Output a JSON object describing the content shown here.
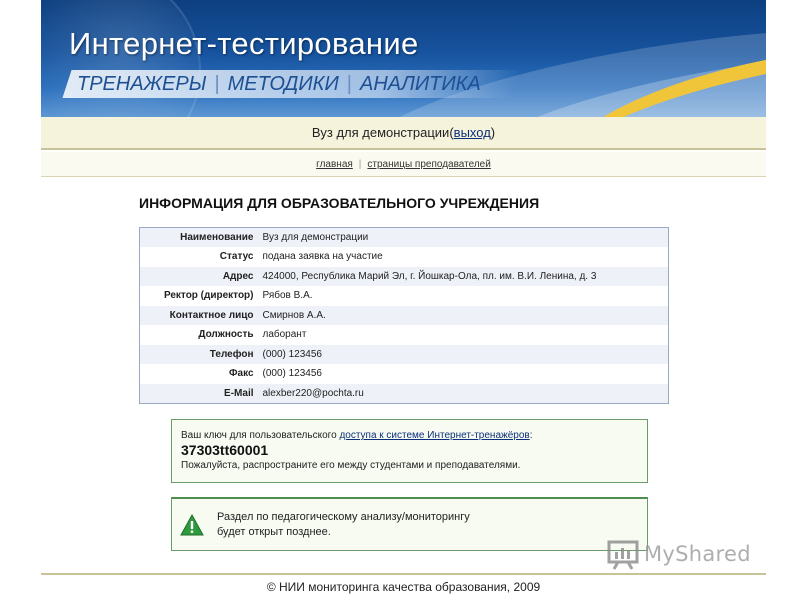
{
  "header": {
    "title": "Интернет-тестирование",
    "nav": [
      {
        "label": "ТРЕНАЖЕРЫ"
      },
      {
        "label": "МЕТОДИКИ"
      },
      {
        "label": "АНАЛИТИКА"
      }
    ],
    "nav_separator": "|"
  },
  "orgbar": {
    "org_name": "Вуз для демонстрации",
    "open_paren": " (",
    "logout_label": "выход",
    "close_paren": ")"
  },
  "subnav": {
    "home_label": "главная",
    "divider": "|",
    "teachers_label": "страницы преподавателей"
  },
  "section_title": "ИНФОРМАЦИЯ ДЛЯ ОБРАЗОВАТЕЛЬНОГО УЧРЕЖДЕНИЯ",
  "info_rows": [
    {
      "label": "Наименование",
      "value": "Вуз для демонстрации"
    },
    {
      "label": "Статус",
      "value": "подана заявка на участие"
    },
    {
      "label": "Адрес",
      "value": "424000, Республика Марий Эл, г. Йошкар-Ола, пл. им. В.И. Ленина, д. 3"
    },
    {
      "label": "Ректор (директор)",
      "value": "Рябов В.А."
    },
    {
      "label": "Контактное лицо",
      "value": "Смирнов А.А."
    },
    {
      "label": "Должность",
      "value": "лаборант"
    },
    {
      "label": "Телефон",
      "value": "(000) 123456"
    },
    {
      "label": "Факс",
      "value": "(000) 123456"
    },
    {
      "label": "E-Mail",
      "value": "alexber220@pochta.ru"
    }
  ],
  "keybox": {
    "intro": "Ваш ключ для пользовательского ",
    "link_label": "доступа к системе Интернет-тренажёров",
    "intro_end": ":",
    "key": "37303tt60001",
    "note": "Пожалуйста, распространите его между студентами и преподавателями."
  },
  "notice": {
    "line1": "Раздел по педагогическому анализу/мониторингу",
    "line2": "будет открыт позднее."
  },
  "footer": "© НИИ мониторинга качества образования, 2009",
  "watermark": {
    "text": "MyShared"
  },
  "colors": {
    "header_blue": "#17539e",
    "accent_gold": "#f0c53a",
    "link_blue": "#0b2f7a",
    "notice_green": "#4d8d4d",
    "warning_icon_green": "#2e9a3e"
  },
  "icons": {
    "notice": "warning-triangle-icon",
    "watermark": "presentation-board-icon"
  }
}
